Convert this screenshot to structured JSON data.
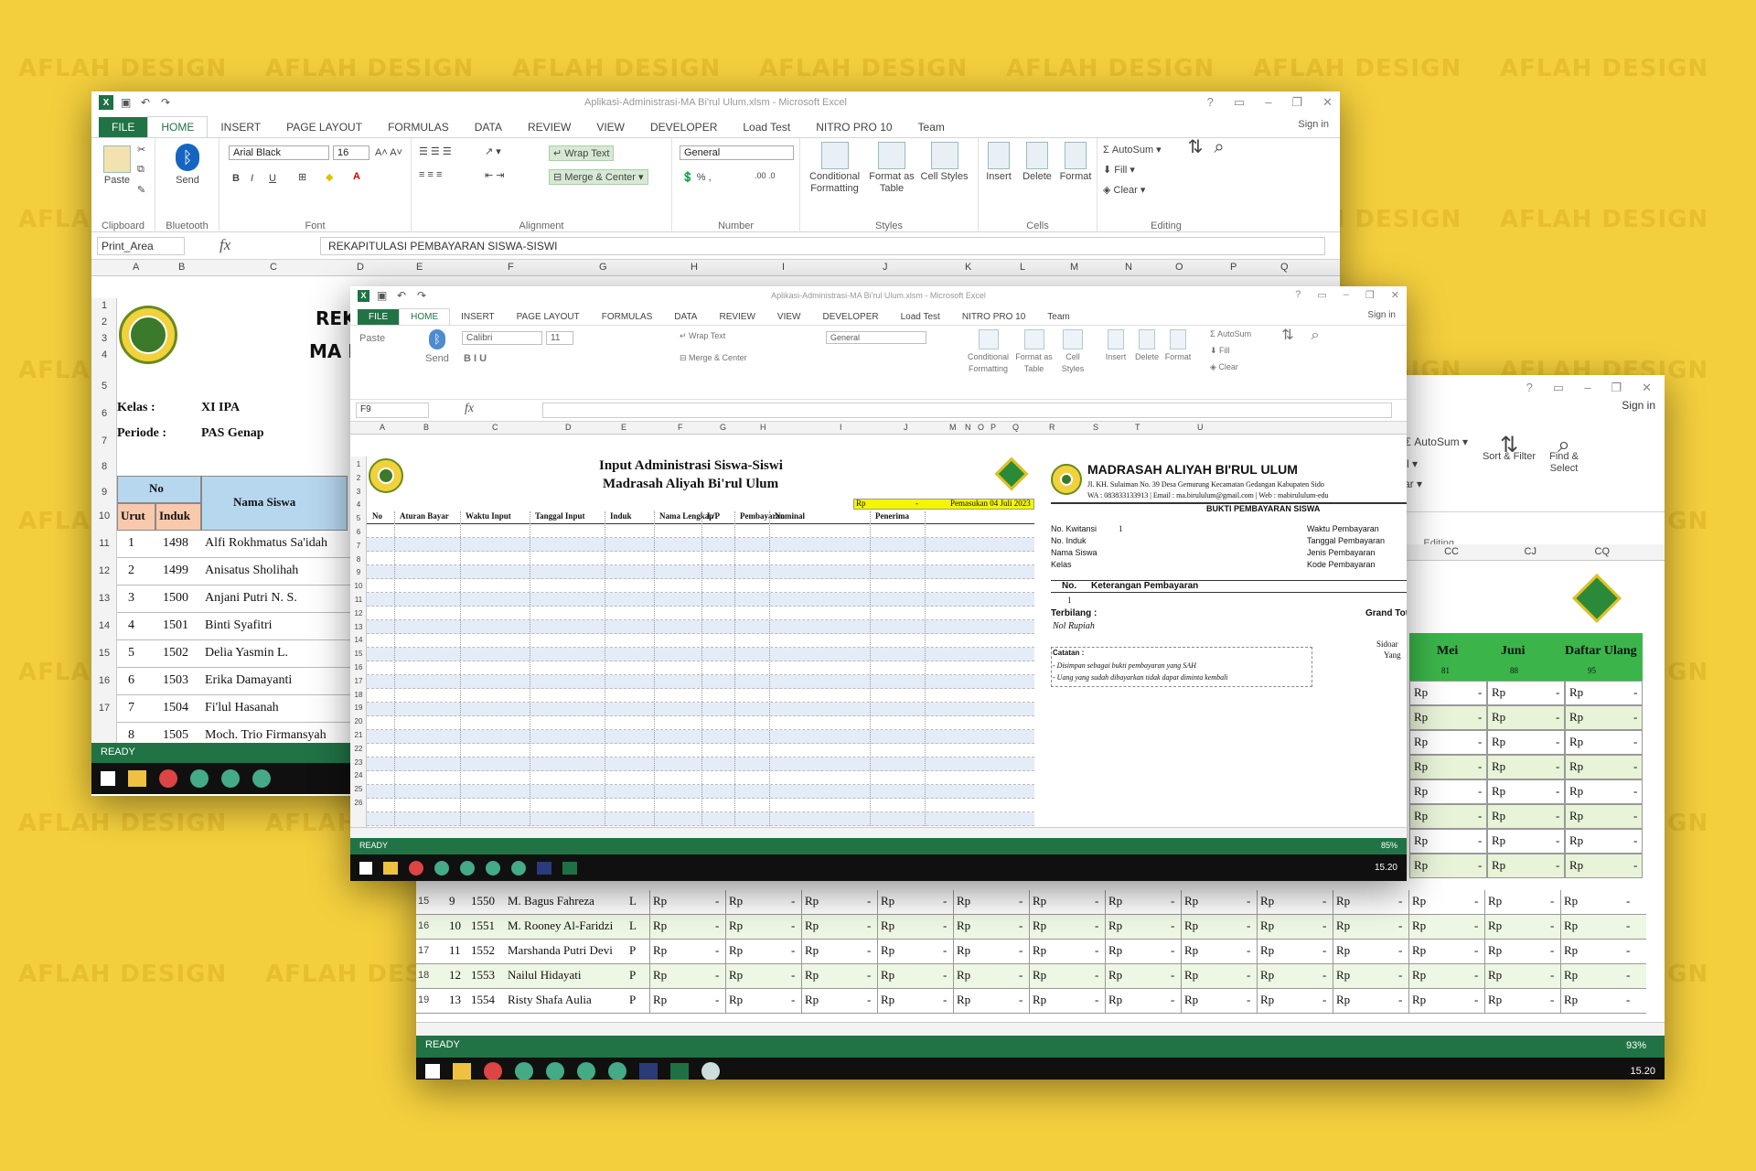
{
  "watermark": "AFLAH DESIGN",
  "excel": {
    "file_tab": "FILE",
    "tabs": [
      "HOME",
      "INSERT",
      "PAGE LAYOUT",
      "FORMULAS",
      "DATA",
      "REVIEW",
      "VIEW",
      "DEVELOPER",
      "Load Test",
      "NITRO PRO 10",
      "Team"
    ],
    "sign_in": "Sign in",
    "ribbon": {
      "paste": "Paste",
      "send": "Send",
      "font_name": "Arial Black",
      "font_size": "16",
      "wrap_text": "Wrap Text",
      "merge_center": "Merge & Center",
      "number_format": "General",
      "conditional_formatting": "Conditional Formatting",
      "format_as_table": "Format as Table",
      "cell_styles": "Cell Styles",
      "insert": "Insert",
      "delete": "Delete",
      "format": "Format",
      "autosum": "AutoSum",
      "fill": "Fill",
      "clear": "Clear",
      "sort_filter": "Sort & Filter",
      "find_select": "Find & Select",
      "groups": [
        "Clipboard",
        "Bluetooth",
        "Font",
        "Alignment",
        "Number",
        "Styles",
        "Cells",
        "Editing"
      ]
    },
    "status_ready": "READY"
  },
  "win1": {
    "title": "Aplikasi-Administrasi-MA Bi'rul Ulum.xlsm - Microsoft Excel",
    "namebox": "Print_Area",
    "formula": "REKAPITULASI PEMBAYARAN SISWA-SISWI",
    "cols": [
      "A",
      "B",
      "C",
      "D",
      "E",
      "F",
      "G",
      "H",
      "I",
      "J",
      "K",
      "L",
      "M",
      "N",
      "O",
      "P",
      "Q"
    ],
    "rows": [
      "1",
      "2",
      "3",
      "4",
      "5",
      "6",
      "7",
      "8",
      "9",
      "10",
      "11",
      "12",
      "13",
      "14",
      "15",
      "16",
      "17"
    ],
    "header_partial1": "REK",
    "header_partial2": "MA I",
    "kelas_label": "Kelas :",
    "kelas_value": "XI IPA",
    "periode_label": "Periode :",
    "periode_value": "PAS Genap",
    "no_label": "No",
    "urut_label": "Urut",
    "induk_label": "Induk",
    "nama_label": "Nama Siswa",
    "students": [
      {
        "urut": "1",
        "induk": "1498",
        "nama": "Alfi Rokhmatus Sa'idah"
      },
      {
        "urut": "2",
        "induk": "1499",
        "nama": "Anisatus Sholihah"
      },
      {
        "urut": "3",
        "induk": "1500",
        "nama": "Anjani Putri N. S."
      },
      {
        "urut": "4",
        "induk": "1501",
        "nama": "Binti Syafitri"
      },
      {
        "urut": "5",
        "induk": "1502",
        "nama": "Delia Yasmin L."
      },
      {
        "urut": "6",
        "induk": "1503",
        "nama": "Erika Damayanti"
      },
      {
        "urut": "7",
        "induk": "1504",
        "nama": "Fi'lul Hasanah"
      },
      {
        "urut": "8",
        "induk": "1505",
        "nama": "Moch. Trio Firmansyah"
      }
    ]
  },
  "win2": {
    "title": "Aplikasi-Administrasi-MA Bi'rul Ulum.xlsm - Microsoft Excel",
    "font_name": "Calibri",
    "font_size": "11",
    "namebox": "F9",
    "cols": [
      "A",
      "B",
      "C",
      "D",
      "E",
      "F",
      "G",
      "H",
      "I",
      "J",
      "M",
      "N",
      "O",
      "P",
      "Q",
      "R",
      "S",
      "T",
      "U"
    ],
    "title1": "Input Administrasi Siswa-Siswi",
    "title2": "Madrasah Aliyah Bi'rul Ulum",
    "rp": "Rp",
    "dash": "-",
    "pemasukan": "Pemasukan 04 Juli 2023",
    "headers": [
      "No",
      "Aturan Bayar",
      "Waktu Input",
      "Tanggal Input",
      "Induk",
      "Nama Lengkap",
      "L/P",
      "Pembayaran",
      "Nominal",
      "Penerima"
    ],
    "rows": [
      "1",
      "2",
      "3",
      "4",
      "5",
      "6",
      "7",
      "8",
      "9",
      "10",
      "11",
      "12",
      "13",
      "14",
      "15",
      "16",
      "17",
      "18",
      "19",
      "20",
      "21",
      "22",
      "23",
      "24",
      "25",
      "26"
    ],
    "school": "MADRASAH ALIYAH BI'RUL ULUM",
    "address": "Jl. KH. Sulaiman No. 39 Desa Gemurung Kecamatan Gedangan Kabupaten Sido",
    "contact": "WA : 083833133913 | Email : ma.birululum@gmail.com | Web : mabirululum-edu",
    "bukti": "BUKTI PEMBAYARAN SISWA",
    "fields_left": [
      "No. Kwitansi",
      "No. Induk",
      "Nama Siswa",
      "Kelas"
    ],
    "kwitansi_value": "1",
    "fields_right": [
      "Waktu Pembayaran",
      "Tanggal Pembayaran",
      "Jenis Pembayaran",
      "Kode Pembayaran"
    ],
    "no_col": "No.",
    "keterangan": "Keterangan Pembayaran",
    "item_no": "1",
    "terbilang": "Terbilang :",
    "terbilang_value": "Nol Rupiah",
    "grand_total": "Grand Tot",
    "sidoarjo": "Sidoar",
    "yang": "Yang",
    "catatan": "Catatan :",
    "note1": "- Disimpan sebagai bukti pembayaran yang SAH",
    "note2": "- Uang yang sudah dibayarkan tidak dapat diminta kembali",
    "zoom": "85%",
    "clock": "15.20"
  },
  "win3": {
    "sign_in": "Sign in",
    "autosum": "AutoSum",
    "fill": "Fill",
    "clear": "Clear",
    "sort_filter": "Sort & Filter",
    "find_select": "Find & Select",
    "editing": "Editing",
    "cols": [
      "CC",
      "CJ",
      "CQ"
    ],
    "month_headers": [
      "Mei",
      "Juni",
      "Daftar Ulang"
    ],
    "counts": [
      "81",
      "88",
      "95"
    ],
    "rp": "Rp",
    "dash": "-",
    "rows": [
      {
        "rn": "15",
        "no": "9",
        "induk": "1550",
        "nama": "M. Bagus Fahreza",
        "lp": "L"
      },
      {
        "rn": "16",
        "no": "10",
        "induk": "1551",
        "nama": "M. Rooney Al-Faridzi",
        "lp": "L"
      },
      {
        "rn": "17",
        "no": "11",
        "induk": "1552",
        "nama": "Marshanda Putri Devi",
        "lp": "P"
      },
      {
        "rn": "18",
        "no": "12",
        "induk": "1553",
        "nama": "Nailul Hidayati",
        "lp": "P"
      },
      {
        "rn": "19",
        "no": "13",
        "induk": "1554",
        "nama": "Risty Shafa Aulia",
        "lp": "P"
      }
    ],
    "zoom": "93%",
    "clock": "15.20"
  }
}
